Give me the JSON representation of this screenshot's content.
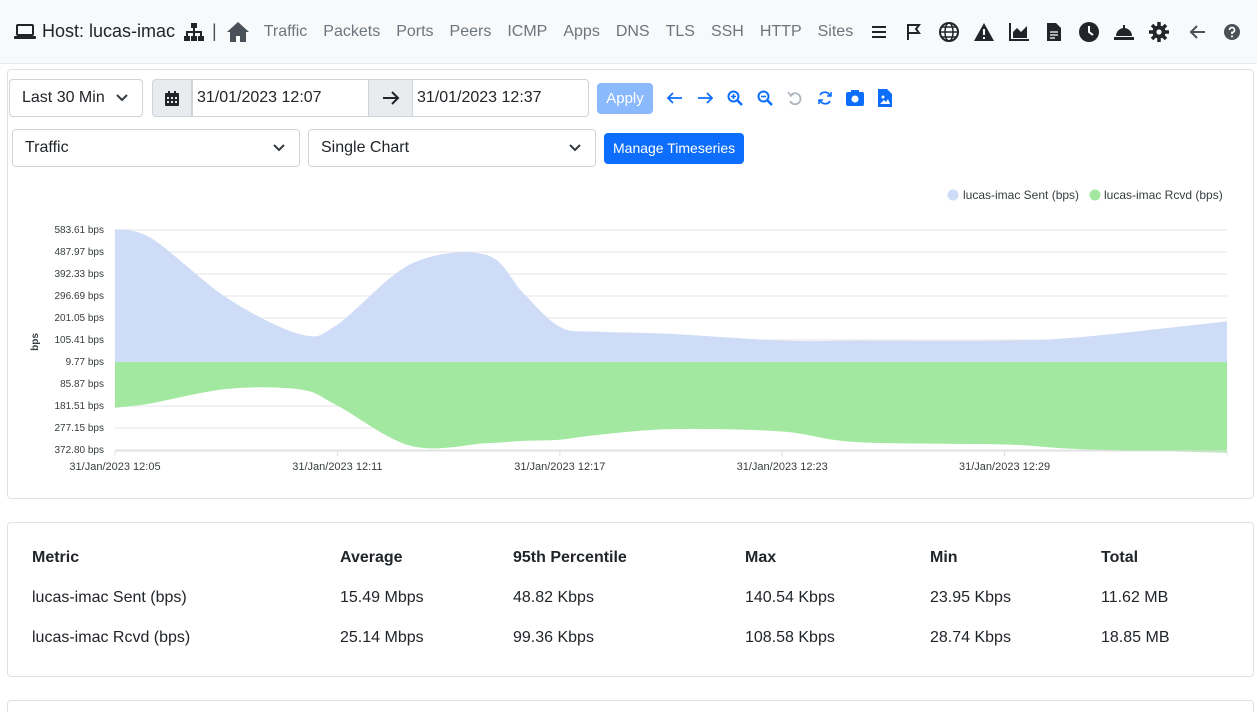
{
  "header": {
    "host_label": "Host: lucas-imac",
    "separator": "|",
    "nav_links": [
      "Traffic",
      "Packets",
      "Ports",
      "Peers",
      "ICMP",
      "Apps",
      "DNS",
      "TLS",
      "SSH",
      "HTTP",
      "Sites"
    ],
    "nav_icons": [
      "list-icon",
      "flag-icon",
      "globe-icon",
      "warning-icon",
      "area-chart-icon",
      "document-icon",
      "clock-icon",
      "bell-icon",
      "gear-icon"
    ],
    "right_icons": [
      "back-arrow-icon",
      "help-icon"
    ]
  },
  "toolbar": {
    "range_select": "Last 30 Min",
    "start_date": "31/01/2023 12:07",
    "end_date": "31/01/2023 12:37",
    "apply_label": "Apply",
    "icons": [
      "arrow-left-icon",
      "arrow-right-icon",
      "zoom-in-icon",
      "zoom-out-icon",
      "undo-icon",
      "refresh-icon",
      "snapshot-icon",
      "image-download-icon"
    ]
  },
  "controls": {
    "metric_select": "Traffic",
    "mode_select": "Single Chart",
    "manage_label": "Manage Timeseries"
  },
  "chart_data": {
    "type": "area",
    "ylabel": "bps",
    "y_ticks": [
      "583.61 bps",
      "487.97 bps",
      "392.33 bps",
      "296.69 bps",
      "201.05 bps",
      "105.41 bps",
      "9.77 bps",
      "85.87 bps",
      "181.51 bps",
      "277.15 bps",
      "372.80 bps"
    ],
    "x_ticks": [
      "31/Jan/2023 12:05",
      "31/Jan/2023 12:11",
      "31/Jan/2023 12:17",
      "31/Jan/2023 12:23",
      "31/Jan/2023 12:29"
    ],
    "x_minutes": [
      5,
      6,
      8,
      10,
      11,
      13,
      15,
      16,
      17,
      18,
      20,
      23,
      25,
      29,
      31,
      35
    ],
    "legend_position": "top-right",
    "series": [
      {
        "name": "lucas-imac Sent (bps)",
        "color": "#cfdcf7",
        "values": [
          583.61,
          540,
          280,
          118,
          160,
          430,
          470,
          300,
          150,
          130,
          120,
          90,
          90,
          90,
          105,
          175
        ]
      },
      {
        "name": "lucas-imac Rcvd (bps)",
        "color": "#a3e8a1",
        "values": [
          -190,
          -170,
          -110,
          -112,
          -180,
          -352,
          -340,
          -330,
          -325,
          -305,
          -280,
          -290,
          -335,
          -345,
          -365,
          -380
        ]
      }
    ],
    "grid": true
  },
  "metrics": {
    "headers": [
      "Metric",
      "Average",
      "95th Percentile",
      "Max",
      "Min",
      "Total"
    ],
    "rows": [
      [
        "lucas-imac Sent (bps)",
        "15.49 Mbps",
        "48.82 Kbps",
        "140.54 Kbps",
        "23.95 Kbps",
        "11.62 MB"
      ],
      [
        "lucas-imac Rcvd (bps)",
        "25.14 Mbps",
        "99.36 Kbps",
        "108.58 Kbps",
        "28.74 Kbps",
        "18.85 MB"
      ]
    ]
  }
}
